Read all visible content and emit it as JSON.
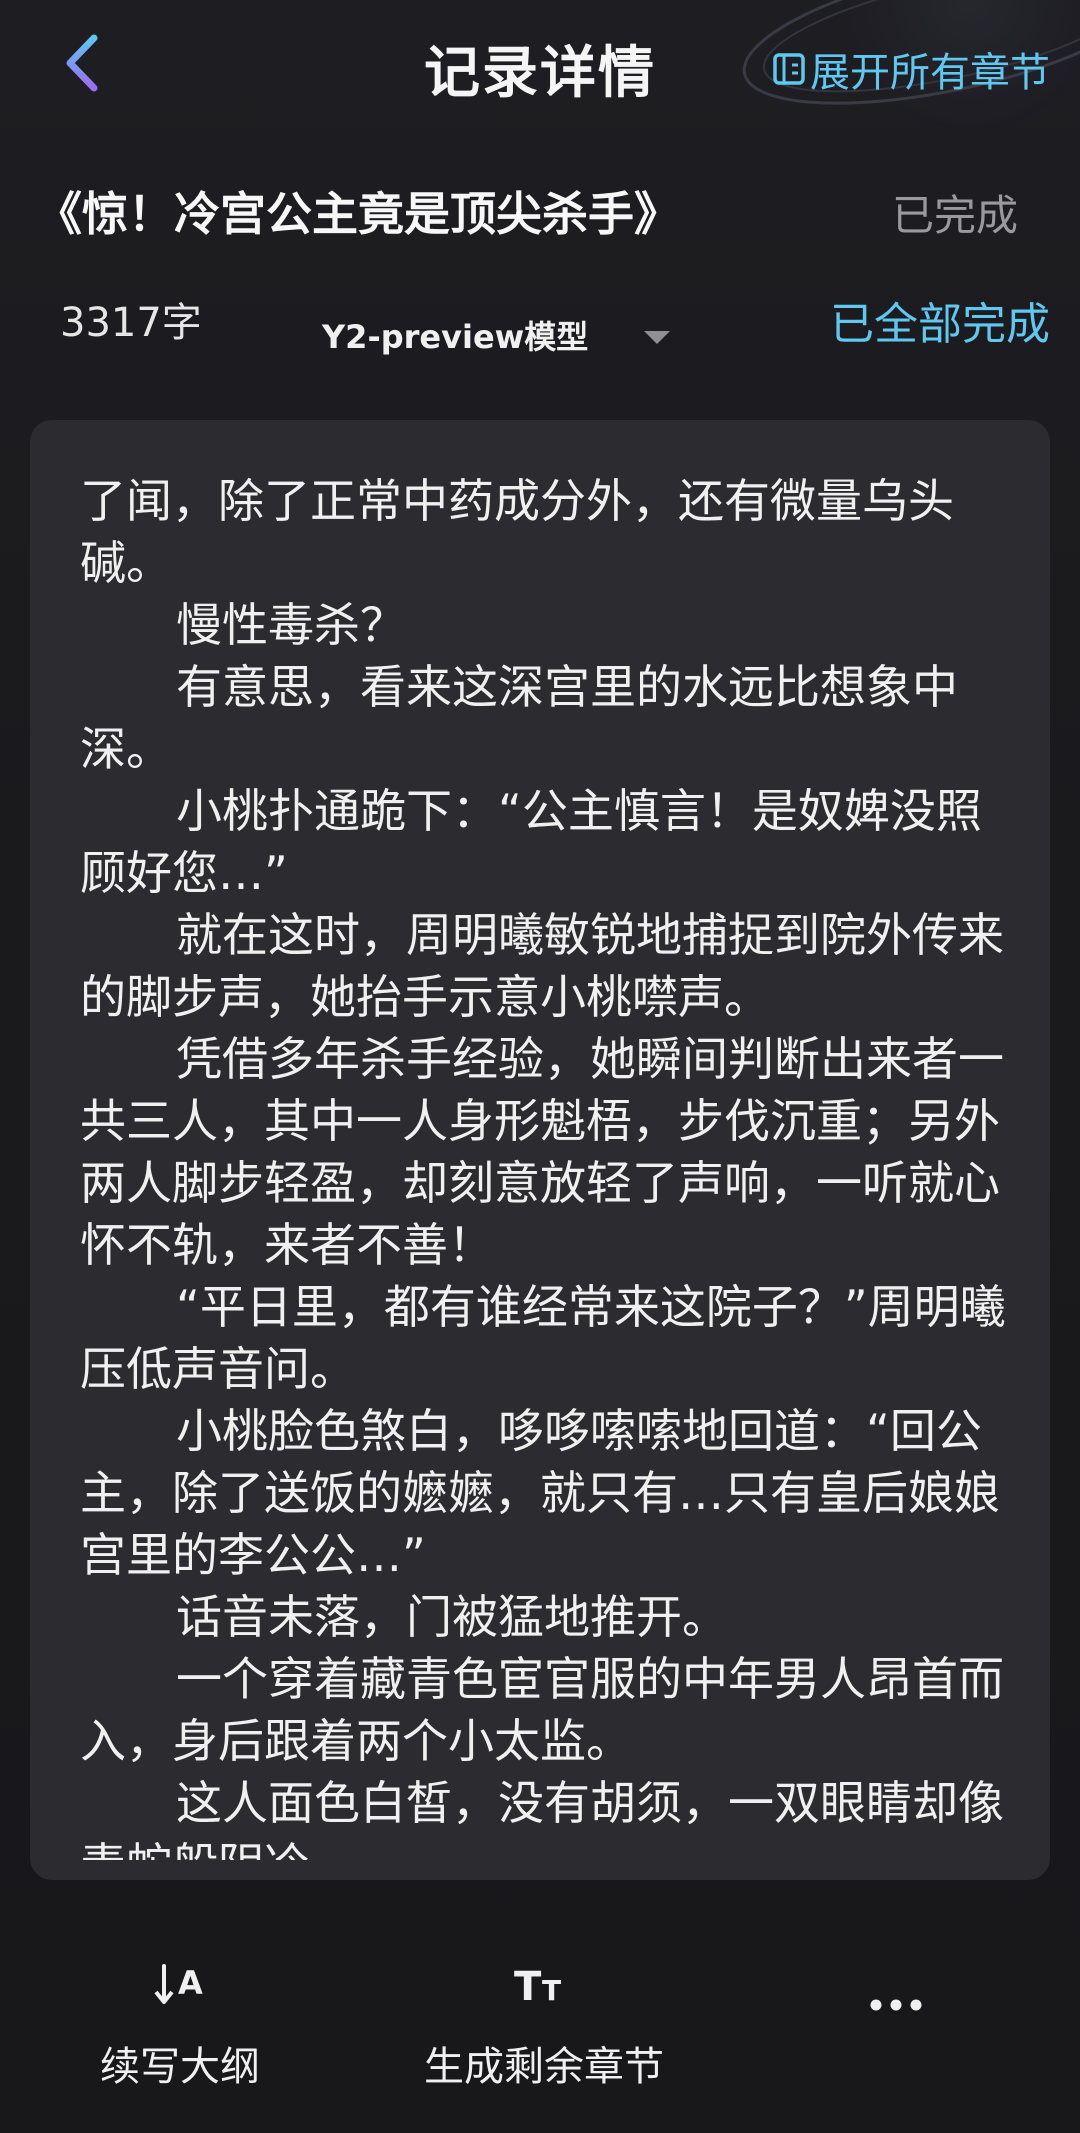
{
  "header": {
    "title": "记录详情",
    "expand_label": "展开所有章节",
    "back_icon": "chevron-left-icon",
    "expand_icon": "expand-icon"
  },
  "book": {
    "title": "《惊！冷宫公主竟是顶尖杀手》",
    "status": "已完成"
  },
  "info": {
    "word_count": "3317字",
    "model": "Y2-preview模型",
    "completion": "已全部完成"
  },
  "content": {
    "paragraphs": [
      {
        "text": "了闻，除了正常中药成分外，还有微量乌头碱。",
        "indent": false
      },
      {
        "text": "慢性毒杀？",
        "indent": true
      },
      {
        "text": "有意思，看来这深宫里的水远比想象中深。",
        "indent": true
      },
      {
        "text": "小桃扑通跪下：“公主慎言！是奴婢没照顾好您…”",
        "indent": true
      },
      {
        "text": "就在这时，周明曦敏锐地捕捉到院外传来的脚步声，她抬手示意小桃噤声。",
        "indent": true
      },
      {
        "text": "凭借多年杀手经验，她瞬间判断出来者一共三人，其中一人身形魁梧，步伐沉重；另外两人脚步轻盈，却刻意放轻了声响，一听就心怀不轨，来者不善！",
        "indent": true
      },
      {
        "text": "“平日里，都有谁经常来这院子？”周明曦压低声音问。",
        "indent": true
      },
      {
        "text": "小桃脸色煞白，哆哆嗦嗦地回道：“回公主，除了送饭的嬷嬷，就只有…只有皇后娘娘宫里的李公公…”",
        "indent": true
      },
      {
        "text": "话音未落，门被猛地推开。",
        "indent": true
      },
      {
        "text": "一个穿着藏青色宦官服的中年男人昂首而入，身后跟着两个小太监。",
        "indent": true
      },
      {
        "text": "这人面色白皙，没有胡须，一双眼睛却像毒蛇般阴冷。",
        "indent": true
      }
    ]
  },
  "toolbar": {
    "outline_label": "续写大纲",
    "generate_label": "生成剩余章节",
    "outline_icon": "arrow-down-a-icon",
    "generate_icon": "text-size-icon",
    "more_icon": "more-dots-icon"
  },
  "colors": {
    "accent": "#5fc8f0",
    "background": "#1a1a1d",
    "card": "#2c2c30",
    "muted": "#9a9a9e"
  }
}
